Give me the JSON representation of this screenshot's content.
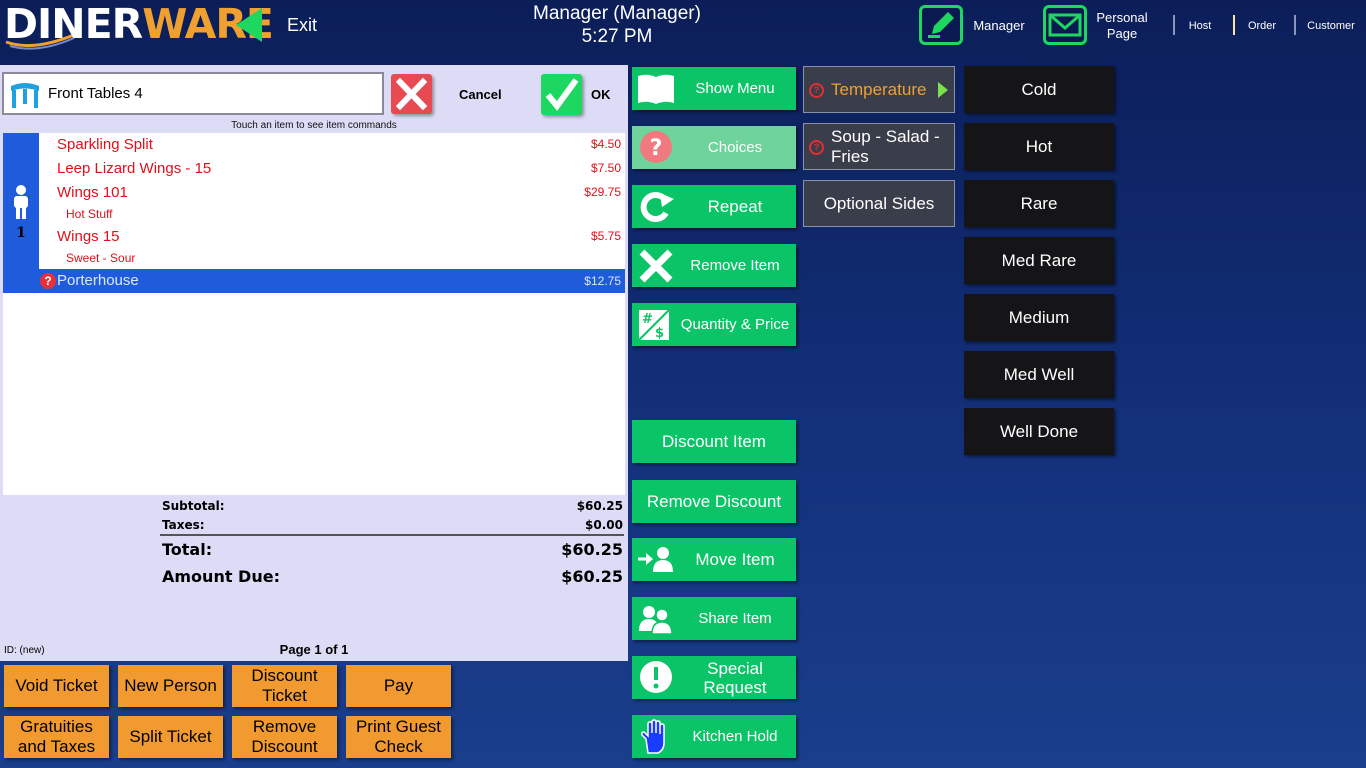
{
  "header": {
    "logo_text": "DINERWARE",
    "exit_label": "Exit",
    "title": "Manager (Manager)",
    "time": "5:27 PM",
    "manager_label": "Manager",
    "personal_page_label": "Personal Page",
    "modes": [
      "Host",
      "Order",
      "Customer"
    ],
    "active_mode": "Order"
  },
  "ticket": {
    "table_name": "Front Tables 4",
    "cancel_label": "Cancel",
    "ok_label": "OK",
    "hint": "Touch an item to see item commands",
    "seat_number": "1",
    "items": [
      {
        "name": "Sparkling Split",
        "price": "$4.50"
      },
      {
        "name": "Leep Lizard Wings - 15",
        "price": "$7.50"
      },
      {
        "name": "Wings 101",
        "price": "$29.75",
        "modifier": "Hot Stuff"
      },
      {
        "name": "Wings 15",
        "price": "$5.75",
        "modifier": "Sweet - Sour"
      }
    ],
    "selected_item": {
      "name": "Porterhouse",
      "price": "$12.75",
      "flag": "?"
    },
    "subtotal_label": "Subtotal:",
    "subtotal": "$60.25",
    "taxes_label": "Taxes:",
    "taxes": "$0.00",
    "total_label": "Total:",
    "total": "$60.25",
    "amount_due_label": "Amount Due:",
    "amount_due": "$60.25",
    "id_label": "ID: (new)",
    "page_label": "Page 1 of 1"
  },
  "bottom_buttons": [
    [
      "Void Ticket",
      "New Person",
      "Discount Ticket",
      "Pay"
    ],
    [
      "Gratuities and Taxes",
      "Split Ticket",
      "Remove Discount",
      "Print Guest Check"
    ]
  ],
  "commands": {
    "show_menu": "Show Menu",
    "choices": "Choices",
    "repeat": "Repeat",
    "remove_item": "Remove Item",
    "quantity_price": "Quantity & Price",
    "discount_item": "Discount Item",
    "remove_discount": "Remove Discount",
    "move_item": "Move Item",
    "share_item": "Share Item",
    "special_request": "Special Request",
    "kitchen_hold": "Kitchen Hold"
  },
  "modifier_groups": [
    {
      "label": "Temperature",
      "required": true,
      "selected": true
    },
    {
      "label": "Soup - Salad - Fries",
      "required": true,
      "selected": false
    },
    {
      "label": "Optional Sides",
      "required": false,
      "selected": false
    }
  ],
  "choices": [
    "Cold",
    "Hot",
    "Rare",
    "Med Rare",
    "Medium",
    "Med Well",
    "Well Done"
  ],
  "colors": {
    "accent_green": "#0cc468",
    "order_orange": "#f09a30",
    "item_red": "#e0101a",
    "seat_blue": "#1f5cdc"
  }
}
